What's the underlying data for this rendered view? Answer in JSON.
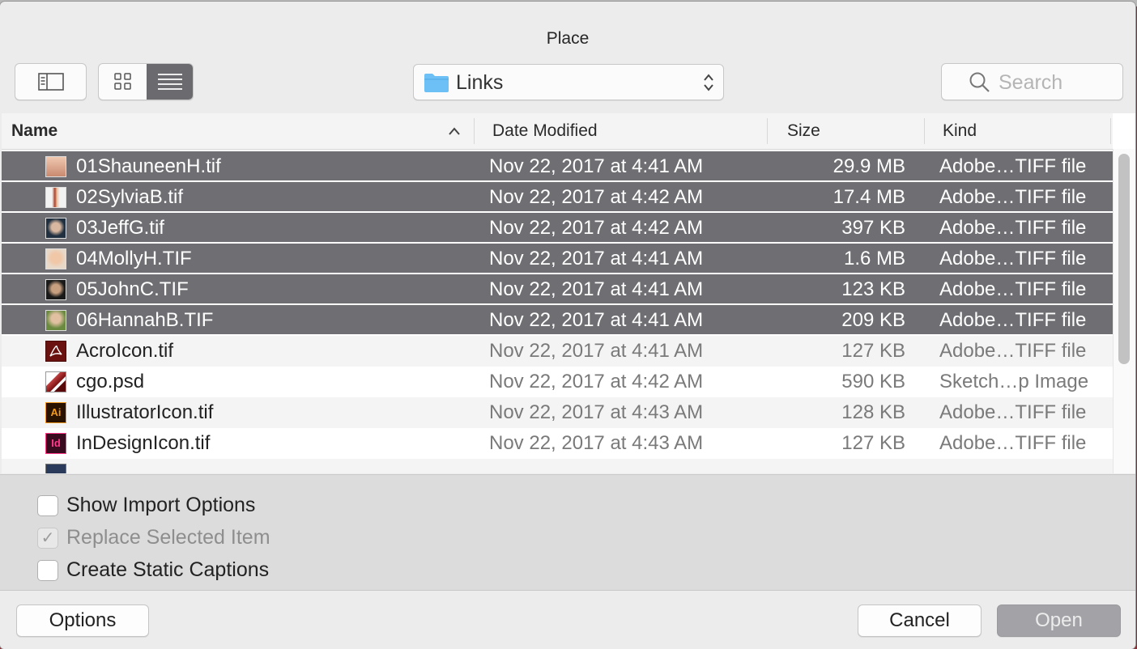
{
  "dialog": {
    "title": "Place"
  },
  "toolbar": {
    "location": "Links",
    "search_placeholder": "Search"
  },
  "columns": {
    "name": "Name",
    "date": "Date Modified",
    "size": "Size",
    "kind": "Kind"
  },
  "files": [
    {
      "name": "01ShauneenH.tif",
      "date": "Nov 22, 2017 at 4:41 AM",
      "size": "29.9 MB",
      "kind": "Adobe…TIFF file"
    },
    {
      "name": "02SylviaB.tif",
      "date": "Nov 22, 2017 at 4:42 AM",
      "size": "17.4 MB",
      "kind": "Adobe…TIFF file"
    },
    {
      "name": "03JeffG.tif",
      "date": "Nov 22, 2017 at 4:42 AM",
      "size": "397 KB",
      "kind": "Adobe…TIFF file"
    },
    {
      "name": "04MollyH.TIF",
      "date": "Nov 22, 2017 at 4:41 AM",
      "size": "1.6 MB",
      "kind": "Adobe…TIFF file"
    },
    {
      "name": "05JohnC.TIF",
      "date": "Nov 22, 2017 at 4:41 AM",
      "size": "123 KB",
      "kind": "Adobe…TIFF file"
    },
    {
      "name": "06HannahB.TIF",
      "date": "Nov 22, 2017 at 4:41 AM",
      "size": "209 KB",
      "kind": "Adobe…TIFF file"
    },
    {
      "name": "AcroIcon.tif",
      "date": "Nov 22, 2017 at 4:41 AM",
      "size": "127 KB",
      "kind": "Adobe…TIFF file"
    },
    {
      "name": "cgo.psd",
      "date": "Nov 22, 2017 at 4:42 AM",
      "size": "590 KB",
      "kind": "Sketch…p Image"
    },
    {
      "name": "IllustratorIcon.tif",
      "date": "Nov 22, 2017 at 4:43 AM",
      "size": "128 KB",
      "kind": "Adobe…TIFF file"
    },
    {
      "name": "InDesignIcon.tif",
      "date": "Nov 22, 2017 at 4:43 AM",
      "size": "127 KB",
      "kind": "Adobe…TIFF file"
    }
  ],
  "options": {
    "show_import": "Show Import Options",
    "replace_selected": "Replace Selected Item",
    "create_captions": "Create Static Captions",
    "check_mark": "✓"
  },
  "buttons": {
    "options": "Options",
    "cancel": "Cancel",
    "open": "Open"
  },
  "colors": {
    "selection": "#6e6e73",
    "folder": "#6cc0f5",
    "app_background": "#8a2f35"
  }
}
